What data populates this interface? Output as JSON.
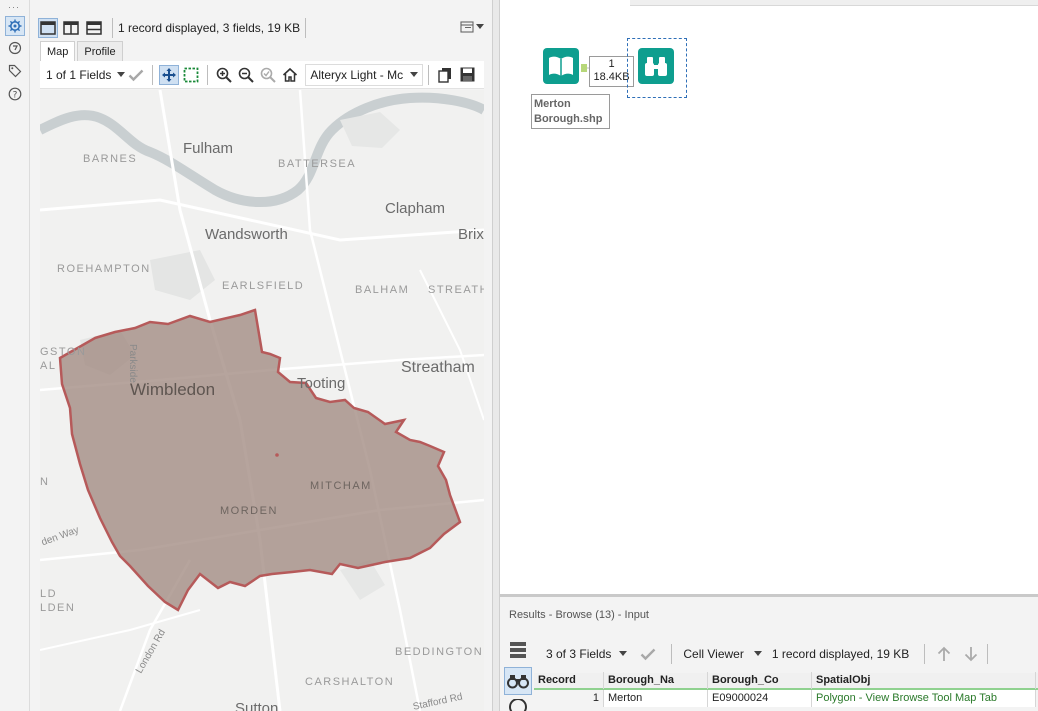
{
  "browse": {
    "status": "1 record displayed, 3 fields, 19 KB",
    "tabs": [
      "Map",
      "Profile"
    ],
    "fields_dropdown": "1 of 1 Fields",
    "basemap_dropdown": "Alteryx Light - Mc"
  },
  "map": {
    "labels": {
      "barnes": "BARNES",
      "fulham": "Fulham",
      "battersea": "BATTERSEA",
      "clapham": "Clapham",
      "wandsworth": "Wandsworth",
      "brix": "Brix",
      "roehampton": "ROEHAMPTON",
      "earlsfield": "EARLSFIELD",
      "balham": "BALHAM",
      "streath": "STREATH",
      "parkside": "Parkside",
      "gston": "GSTON",
      "al": "AL",
      "wimbledon": "Wimbledon",
      "tooting": "Tooting",
      "streatham": "Streatham",
      "mitcham": "MITCHAM",
      "morden": "MORDEN",
      "n": "N",
      "den_way": "den Way",
      "ld": "LD",
      "lden": "LDEN",
      "london_rd": "London Rd",
      "beddington": "BEDDINGTON",
      "carshalton": "CARSHALTON",
      "sutton": "Sutton",
      "stafford_rd": "Stafford Rd"
    },
    "polygon_fill": "#a18a82",
    "polygon_stroke": "#b65a5a"
  },
  "canvas": {
    "connection_count": "1",
    "connection_size": "18.4KB",
    "tool_label_line1": "Merton",
    "tool_label_line2": "Borough.shp"
  },
  "results": {
    "title": "Results - Browse (13) - Input",
    "fields_dropdown": "3 of 3 Fields",
    "cell_viewer": "Cell Viewer",
    "status": "1 record displayed, 19 KB",
    "columns": [
      "Record",
      "Borough_Na",
      "Borough_Co",
      "SpatialObj"
    ],
    "rows": [
      [
        "1",
        "Merton",
        "E09000024",
        "Polygon - View Browse Tool Map Tab"
      ]
    ]
  },
  "colors": {
    "accent": "#0e9e8f",
    "selection": "#2f6fb7"
  }
}
